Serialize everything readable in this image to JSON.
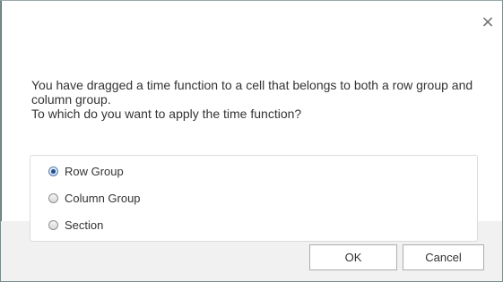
{
  "dialog": {
    "close_glyph": "×",
    "message_line1": "You have dragged a time function to a cell that belongs to both a row group and column group.",
    "message_line2": "To which do you want to apply the time function?"
  },
  "options": [
    {
      "label": "Row Group",
      "selected": true
    },
    {
      "label": "Column Group",
      "selected": false
    },
    {
      "label": "Section",
      "selected": false
    }
  ],
  "buttons": {
    "ok": "OK",
    "cancel": "Cancel"
  },
  "colors": {
    "border": "#7a8c8c",
    "footer_band": "#f1f1f1",
    "radio_selected": "#1f4f8f"
  },
  "icons": {
    "close": "close-icon",
    "radio": "radio-icon"
  }
}
